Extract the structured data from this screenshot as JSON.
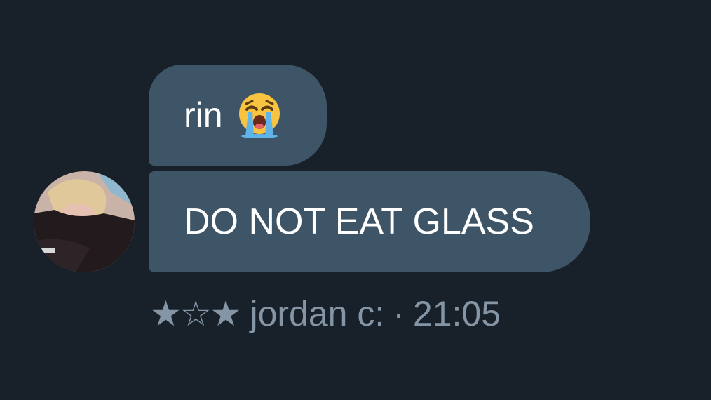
{
  "messages": [
    {
      "text": "rin",
      "emoji": "loudly-crying-face"
    },
    {
      "text": "DO NOT EAT GLASS"
    }
  ],
  "sender": {
    "stars": "★☆★",
    "name": "jordan c:",
    "separator": "·",
    "time": "21:05",
    "avatar": "profile-photo"
  },
  "colors": {
    "background": "#18202a",
    "bubble": "#3e5568",
    "bubble_text": "#ffffff",
    "meta_text": "#8496a6"
  }
}
